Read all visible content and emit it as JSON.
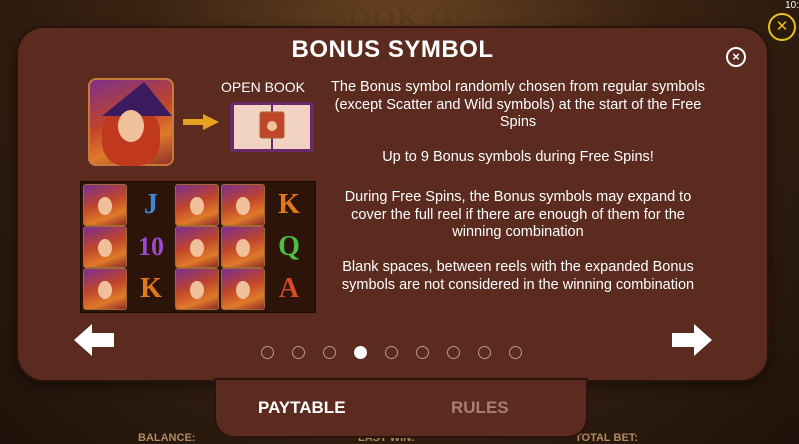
{
  "game": {
    "logo_text": "BOOK OF WITCHES",
    "clock": "10:",
    "bottom": {
      "balance": "BALANCE:",
      "last_win": "LAST WIN:",
      "total_bet": "TOTAL BET:"
    }
  },
  "modal": {
    "title": "BONUS SYMBOL",
    "close_glyph": "×",
    "open_book_label": "OPEN BOOK",
    "paragraphs": [
      "The Bonus symbol randomly chosen from regular symbols (except Scatter and Wild symbols) at the start of the Free Spins",
      "Up to 9 Bonus symbols during Free Spins!",
      "During Free Spins, the Bonus symbols may expand to cover the full reel if there are enough of them for the winning combination",
      "Blank spaces, between reels with the expanded Bonus symbols are not considered in the winning combination"
    ],
    "grid": {
      "col2": [
        "J",
        "10",
        "K"
      ],
      "col5": [
        "K",
        "Q",
        "A"
      ]
    },
    "pagination": {
      "total": 9,
      "active_index": 3
    }
  },
  "tabs": {
    "paytable": "PAYTABLE",
    "rules": "RULES"
  },
  "colors": {
    "modal_bg": "#5a2b1e",
    "accent_yellow": "#e6c21e",
    "symbol_orange": "#e0781e",
    "symbol_blue": "#3a8ad8",
    "symbol_purple": "#9a4ad0",
    "symbol_green": "#4cc040",
    "symbol_red": "#d84a2a"
  }
}
